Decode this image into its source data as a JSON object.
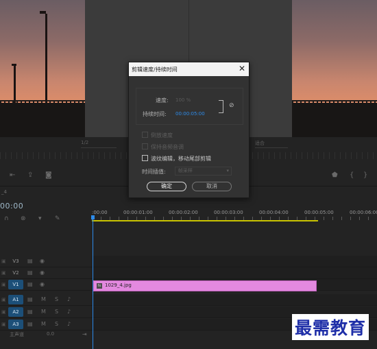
{
  "monitor": {
    "resolution_select": "1/2",
    "quality_select": "适合"
  },
  "dialog": {
    "title": "剪辑速度/持续时间",
    "speed_label": "速度:",
    "speed_value": "100 %",
    "duration_label": "持续时间:",
    "duration_value": "00:00:05:00",
    "checkboxes": [
      {
        "label": "倒放速度",
        "checked": false,
        "enabled": false
      },
      {
        "label": "保持音频音调",
        "checked": false,
        "enabled": false
      },
      {
        "label": "波纹编辑，移动尾部剪辑",
        "checked": false,
        "enabled": true
      }
    ],
    "interp_label": "时间插值:",
    "interp_value": "帧采样",
    "ok_label": "确定",
    "cancel_label": "取消"
  },
  "timeline": {
    "sequence_name": "_4",
    "timecode": "00:00",
    "ruler": [
      ":00:00",
      "00:00:01:00",
      "00:00:02:00",
      "00:00:03:00",
      "00:00:04:00",
      "00:00:05:00",
      "00:00:06:00"
    ],
    "video_tracks": [
      "V3",
      "V2",
      "V1"
    ],
    "audio_tracks": [
      "A1",
      "A2",
      "A3"
    ],
    "clip": {
      "name": "1029_4.jpg",
      "color": "#e389df"
    },
    "master": {
      "label": "主声道",
      "value": "0.0"
    }
  },
  "watermark": "最需教育"
}
